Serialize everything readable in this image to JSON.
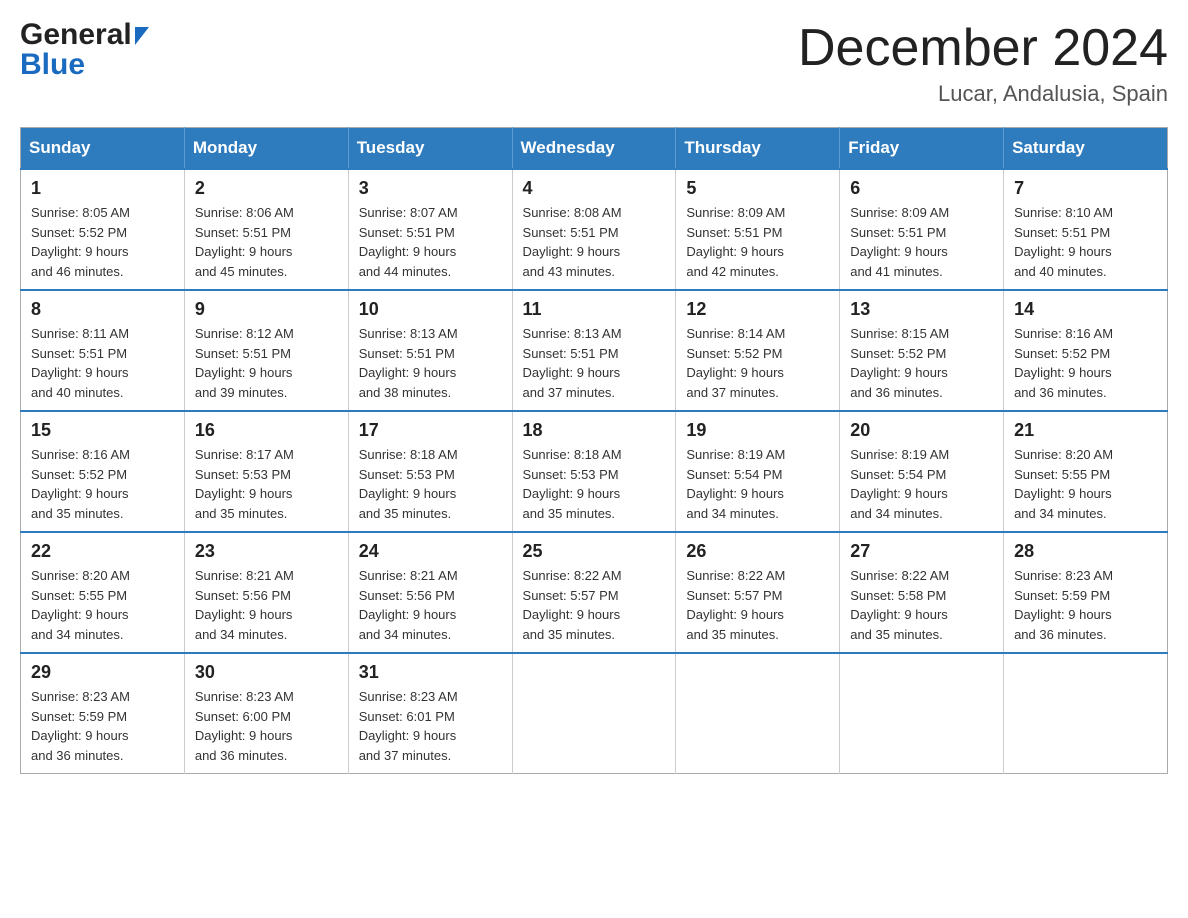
{
  "header": {
    "logo_general": "General",
    "logo_blue": "Blue",
    "month_title": "December 2024",
    "location": "Lucar, Andalusia, Spain"
  },
  "days_of_week": [
    "Sunday",
    "Monday",
    "Tuesday",
    "Wednesday",
    "Thursday",
    "Friday",
    "Saturday"
  ],
  "weeks": [
    [
      {
        "day": "1",
        "sunrise": "8:05 AM",
        "sunset": "5:52 PM",
        "daylight": "9 hours and 46 minutes."
      },
      {
        "day": "2",
        "sunrise": "8:06 AM",
        "sunset": "5:51 PM",
        "daylight": "9 hours and 45 minutes."
      },
      {
        "day": "3",
        "sunrise": "8:07 AM",
        "sunset": "5:51 PM",
        "daylight": "9 hours and 44 minutes."
      },
      {
        "day": "4",
        "sunrise": "8:08 AM",
        "sunset": "5:51 PM",
        "daylight": "9 hours and 43 minutes."
      },
      {
        "day": "5",
        "sunrise": "8:09 AM",
        "sunset": "5:51 PM",
        "daylight": "9 hours and 42 minutes."
      },
      {
        "day": "6",
        "sunrise": "8:09 AM",
        "sunset": "5:51 PM",
        "daylight": "9 hours and 41 minutes."
      },
      {
        "day": "7",
        "sunrise": "8:10 AM",
        "sunset": "5:51 PM",
        "daylight": "9 hours and 40 minutes."
      }
    ],
    [
      {
        "day": "8",
        "sunrise": "8:11 AM",
        "sunset": "5:51 PM",
        "daylight": "9 hours and 40 minutes."
      },
      {
        "day": "9",
        "sunrise": "8:12 AM",
        "sunset": "5:51 PM",
        "daylight": "9 hours and 39 minutes."
      },
      {
        "day": "10",
        "sunrise": "8:13 AM",
        "sunset": "5:51 PM",
        "daylight": "9 hours and 38 minutes."
      },
      {
        "day": "11",
        "sunrise": "8:13 AM",
        "sunset": "5:51 PM",
        "daylight": "9 hours and 37 minutes."
      },
      {
        "day": "12",
        "sunrise": "8:14 AM",
        "sunset": "5:52 PM",
        "daylight": "9 hours and 37 minutes."
      },
      {
        "day": "13",
        "sunrise": "8:15 AM",
        "sunset": "5:52 PM",
        "daylight": "9 hours and 36 minutes."
      },
      {
        "day": "14",
        "sunrise": "8:16 AM",
        "sunset": "5:52 PM",
        "daylight": "9 hours and 36 minutes."
      }
    ],
    [
      {
        "day": "15",
        "sunrise": "8:16 AM",
        "sunset": "5:52 PM",
        "daylight": "9 hours and 35 minutes."
      },
      {
        "day": "16",
        "sunrise": "8:17 AM",
        "sunset": "5:53 PM",
        "daylight": "9 hours and 35 minutes."
      },
      {
        "day": "17",
        "sunrise": "8:18 AM",
        "sunset": "5:53 PM",
        "daylight": "9 hours and 35 minutes."
      },
      {
        "day": "18",
        "sunrise": "8:18 AM",
        "sunset": "5:53 PM",
        "daylight": "9 hours and 35 minutes."
      },
      {
        "day": "19",
        "sunrise": "8:19 AM",
        "sunset": "5:54 PM",
        "daylight": "9 hours and 34 minutes."
      },
      {
        "day": "20",
        "sunrise": "8:19 AM",
        "sunset": "5:54 PM",
        "daylight": "9 hours and 34 minutes."
      },
      {
        "day": "21",
        "sunrise": "8:20 AM",
        "sunset": "5:55 PM",
        "daylight": "9 hours and 34 minutes."
      }
    ],
    [
      {
        "day": "22",
        "sunrise": "8:20 AM",
        "sunset": "5:55 PM",
        "daylight": "9 hours and 34 minutes."
      },
      {
        "day": "23",
        "sunrise": "8:21 AM",
        "sunset": "5:56 PM",
        "daylight": "9 hours and 34 minutes."
      },
      {
        "day": "24",
        "sunrise": "8:21 AM",
        "sunset": "5:56 PM",
        "daylight": "9 hours and 34 minutes."
      },
      {
        "day": "25",
        "sunrise": "8:22 AM",
        "sunset": "5:57 PM",
        "daylight": "9 hours and 35 minutes."
      },
      {
        "day": "26",
        "sunrise": "8:22 AM",
        "sunset": "5:57 PM",
        "daylight": "9 hours and 35 minutes."
      },
      {
        "day": "27",
        "sunrise": "8:22 AM",
        "sunset": "5:58 PM",
        "daylight": "9 hours and 35 minutes."
      },
      {
        "day": "28",
        "sunrise": "8:23 AM",
        "sunset": "5:59 PM",
        "daylight": "9 hours and 36 minutes."
      }
    ],
    [
      {
        "day": "29",
        "sunrise": "8:23 AM",
        "sunset": "5:59 PM",
        "daylight": "9 hours and 36 minutes."
      },
      {
        "day": "30",
        "sunrise": "8:23 AM",
        "sunset": "6:00 PM",
        "daylight": "9 hours and 36 minutes."
      },
      {
        "day": "31",
        "sunrise": "8:23 AM",
        "sunset": "6:01 PM",
        "daylight": "9 hours and 37 minutes."
      },
      null,
      null,
      null,
      null
    ]
  ],
  "labels": {
    "sunrise": "Sunrise:",
    "sunset": "Sunset:",
    "daylight": "Daylight:"
  }
}
